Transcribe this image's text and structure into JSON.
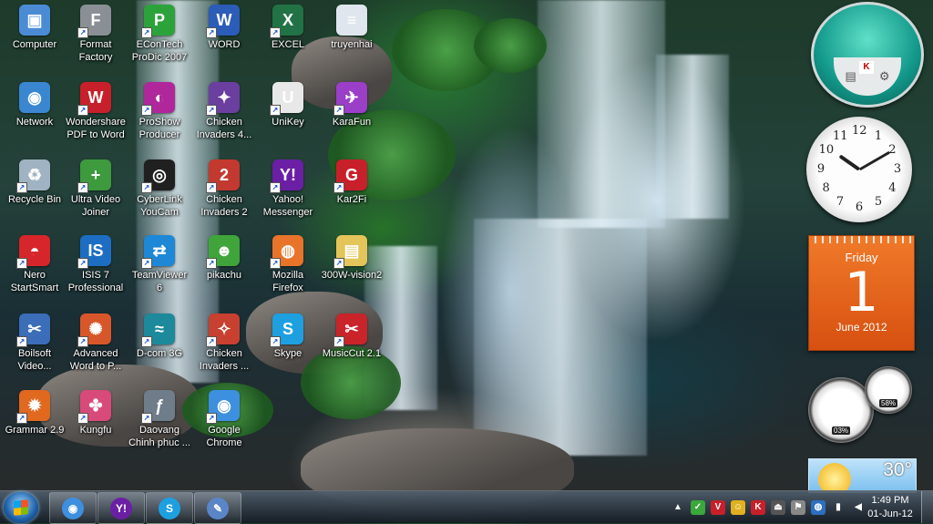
{
  "desktop_icons": [
    {
      "label": "Computer",
      "icon": "computer-icon",
      "color": "#4b8bd6",
      "glyph": "▣"
    },
    {
      "label": "Format\nFactory",
      "icon": "format-factory-icon",
      "color": "#8a8f96",
      "glyph": "F"
    },
    {
      "label": "EConTech\nProDic 2007",
      "icon": "econtech-icon",
      "color": "#2ca33a",
      "glyph": "P"
    },
    {
      "label": "WORD",
      "icon": "word-icon",
      "color": "#2b5cb8",
      "glyph": "W"
    },
    {
      "label": "EXCEL",
      "icon": "excel-icon",
      "color": "#217346",
      "glyph": "X"
    },
    {
      "label": "truyenhai",
      "icon": "text-file-icon",
      "color": "#dfe6ee",
      "glyph": "≡"
    },
    {
      "label": "Network",
      "icon": "network-icon",
      "color": "#3a86d0",
      "glyph": "◉"
    },
    {
      "label": "Wondershare\nPDF to Word",
      "icon": "pdf-to-word-icon",
      "color": "#c8202a",
      "glyph": "W"
    },
    {
      "label": "ProShow\nProducer",
      "icon": "proshow-icon",
      "color": "#b0279c",
      "glyph": "◐"
    },
    {
      "label": "Chicken\nInvaders 4...",
      "icon": "chicken-invaders-4-icon",
      "color": "#6a3fa0",
      "glyph": "✦"
    },
    {
      "label": "UniKey",
      "icon": "unikey-icon",
      "color": "#e8e8e8",
      "glyph": "U"
    },
    {
      "label": "KaraFun",
      "icon": "karafun-icon",
      "color": "#9b3ec8",
      "glyph": "✈"
    },
    {
      "label": "Recycle Bin",
      "icon": "recycle-bin-icon",
      "color": "#9fb3c2",
      "glyph": "♻"
    },
    {
      "label": "Ultra Video\nJoiner",
      "icon": "video-joiner-icon",
      "color": "#3d9a3d",
      "glyph": "+"
    },
    {
      "label": "CyberLink\nYouCam",
      "icon": "youcam-icon",
      "color": "#202020",
      "glyph": "◎"
    },
    {
      "label": "Chicken\nInvaders 2",
      "icon": "chicken-invaders-2-icon",
      "color": "#c4392f",
      "glyph": "2"
    },
    {
      "label": "Yahoo!\nMessenger",
      "icon": "yahoo-messenger-icon",
      "color": "#6b1fa5",
      "glyph": "Y!"
    },
    {
      "label": "Kar2Fi",
      "icon": "kar2fi-icon",
      "color": "#c8202a",
      "glyph": "G"
    },
    {
      "label": "Nero\nStartSmart",
      "icon": "nero-icon",
      "color": "#d6262b",
      "glyph": "◓"
    },
    {
      "label": "ISIS 7\nProfessional",
      "icon": "isis-icon",
      "color": "#1d6ec2",
      "glyph": "IS"
    },
    {
      "label": "TeamViewer\n6",
      "icon": "teamviewer-icon",
      "color": "#1e88d6",
      "glyph": "⇄"
    },
    {
      "label": "pikachu",
      "icon": "pikachu-icon",
      "color": "#3fa53a",
      "glyph": "☻"
    },
    {
      "label": "Mozilla\nFirefox",
      "icon": "firefox-icon",
      "color": "#e8742a",
      "glyph": "◍"
    },
    {
      "label": "300W-vision2",
      "icon": "folder-icon",
      "color": "#e4c55a",
      "glyph": "▤"
    },
    {
      "label": "Boilsoft\nVideo...",
      "icon": "boilsoft-icon",
      "color": "#3b6db8",
      "glyph": "✂"
    },
    {
      "label": "Advanced\nWord to P...",
      "icon": "advanced-word-icon",
      "color": "#d8572a",
      "glyph": "✺"
    },
    {
      "label": "D-com 3G",
      "icon": "dcom-icon",
      "color": "#1c8a9a",
      "glyph": "≈"
    },
    {
      "label": "Chicken\nInvaders ...",
      "icon": "chicken-invaders-icon",
      "color": "#c8402f",
      "glyph": "✧"
    },
    {
      "label": "Skype",
      "icon": "skype-icon",
      "color": "#1ea0e0",
      "glyph": "S"
    },
    {
      "label": "MusicCut 2.1",
      "icon": "musiccut-icon",
      "color": "#c8242a",
      "glyph": "✂"
    },
    {
      "label": "Grammar 2.9",
      "icon": "grammar-icon",
      "color": "#e0681f",
      "glyph": "✹"
    },
    {
      "label": "Kungfu",
      "icon": "kungfu-icon",
      "color": "#d84a7a",
      "glyph": "✤"
    },
    {
      "label": "Daovang\nChinh phuc ...",
      "icon": "flash-icon",
      "color": "#6f7c8a",
      "glyph": "ƒ"
    },
    {
      "label": "Google\nChrome",
      "icon": "chrome-icon",
      "color": "#3d8fe0",
      "glyph": "◉"
    }
  ],
  "gadgets": {
    "calendar": {
      "weekday": "Friday",
      "day": "1",
      "month_year": "June 2012",
      "color": "#e4621b"
    },
    "clock": {
      "hour": 10,
      "minute": 10,
      "numerals": [
        "12",
        "1",
        "2",
        "3",
        "4",
        "5",
        "6",
        "7",
        "8",
        "9",
        "10",
        "11"
      ]
    },
    "cpu_meter": {
      "cpu": "03%",
      "memory": "58%"
    },
    "weather": {
      "temperature": "30°"
    },
    "antivirus": {
      "brand_mark": "K"
    }
  },
  "taskbar": {
    "pinned": [
      {
        "name": "chrome",
        "icon": "chrome-icon",
        "color": "#3d8fe0",
        "glyph": "◉"
      },
      {
        "name": "yahoo",
        "icon": "yahoo-messenger-icon",
        "color": "#6b1fa5",
        "glyph": "Y!"
      },
      {
        "name": "skype",
        "icon": "skype-icon",
        "color": "#1ea0e0",
        "glyph": "S"
      },
      {
        "name": "paint",
        "icon": "paint-icon",
        "color": "#5a86c8",
        "glyph": "✎"
      }
    ],
    "tray_icons": [
      {
        "icon": "show-hidden-icons-icon",
        "color": "transparent",
        "glyph": "▲"
      },
      {
        "icon": "line-icon",
        "color": "#3aa83a",
        "glyph": "✓"
      },
      {
        "icon": "unikey-tray-icon",
        "color": "#c8202a",
        "glyph": "V"
      },
      {
        "icon": "yahoo-tray-icon",
        "color": "#e0b020",
        "glyph": "☺"
      },
      {
        "icon": "kaspersky-tray-icon",
        "color": "#c8202a",
        "glyph": "K"
      },
      {
        "icon": "usb-tray-icon",
        "color": "#555",
        "glyph": "⏏"
      },
      {
        "icon": "action-center-icon",
        "color": "#888",
        "glyph": "⚑"
      },
      {
        "icon": "network-tray-icon",
        "color": "#2d6fc0",
        "glyph": "◍"
      },
      {
        "icon": "signal-tray-icon",
        "color": "transparent",
        "glyph": "▮"
      },
      {
        "icon": "volume-tray-icon",
        "color": "transparent",
        "glyph": "◀"
      }
    ],
    "time": "1:49 PM",
    "date": "01-Jun-12"
  }
}
